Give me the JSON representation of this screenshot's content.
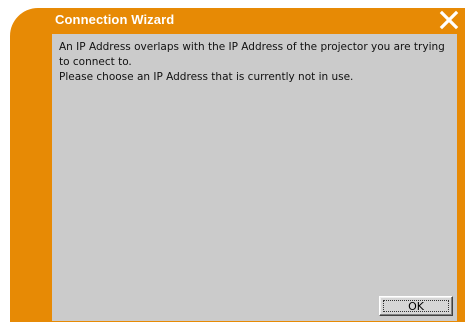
{
  "window": {
    "title": "Connection Wizard",
    "accent_color": "#e78a05",
    "content_background": "#cbcbcb"
  },
  "title_bar": {
    "close_icon": "close-icon"
  },
  "message": {
    "lines": [
      "An IP Address overlaps with the IP Address of the projector you are trying to connect to.",
      "Please choose an IP Address that is currently not in use."
    ]
  },
  "buttons": {
    "ok_label": "OK"
  }
}
